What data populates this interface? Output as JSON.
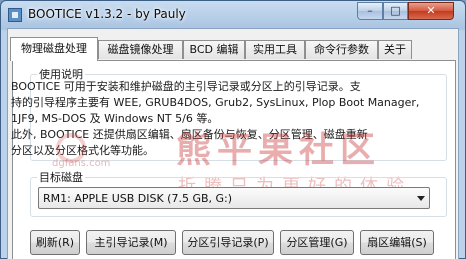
{
  "window": {
    "title": "BOOTICE v1.3.2 - by Pauly",
    "minimize": "–",
    "maximize": "□",
    "close": "✕"
  },
  "tabs": [
    {
      "label": "物理磁盘处理",
      "active": true
    },
    {
      "label": "磁盘镜像处理",
      "active": false
    },
    {
      "label": "BCD 编辑",
      "active": false
    },
    {
      "label": "实用工具",
      "active": false
    },
    {
      "label": "命令行参数",
      "active": false
    },
    {
      "label": "关于",
      "active": false
    }
  ],
  "usage": {
    "legend": "使用说明",
    "line1": "BOOTICE 可用于安装和维护磁盘的主引导记录或分区上的引导记录。支",
    "line2": "持的引导程序主要有 WEE, GRUB4DOS, Grub2, SysLinux, Plop Boot Manager,",
    "line3": "1JF9, MS-DOS 及 Windows NT 5/6 等。",
    "line4": "此外, BOOTICE 还提供扇区编辑、扇区备份与恢复、分区管理、磁盘重新",
    "line5": "分区以及分区格式化等功能。"
  },
  "watermark": {
    "url": "dgfans.com",
    "main": "熊平果社区",
    "sub": "折腾只为更好的体验"
  },
  "target": {
    "legend": "目标磁盘",
    "selected": "RM1: APPLE USB DISK (7.5 GB, G:)"
  },
  "buttons": {
    "refresh": "刷新(R)",
    "mbr": "主引导记录(M)",
    "pbr": "分区引导记录(P)",
    "parts": "分区管理(G)",
    "sector": "扇区编辑(S)"
  }
}
